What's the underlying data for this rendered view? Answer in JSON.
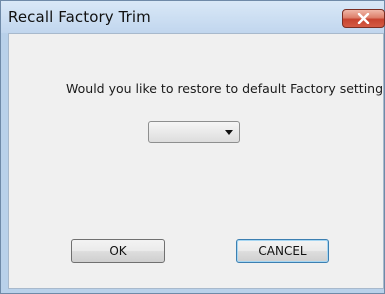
{
  "window": {
    "title": "Recall Factory Trim"
  },
  "dialog": {
    "message": "Would you like to restore to default Factory setting",
    "dropdown_value": "",
    "ok_label": "OK",
    "cancel_label": "CANCEL"
  },
  "icons": {
    "close": "close-icon",
    "dropdown_arrow": "dropdown-arrow-icon"
  },
  "colors": {
    "titlebar": "#c9dcf1",
    "close_button": "#c7432f",
    "client_background": "#f0f0f0",
    "default_button_border": "#3c7fb1"
  }
}
